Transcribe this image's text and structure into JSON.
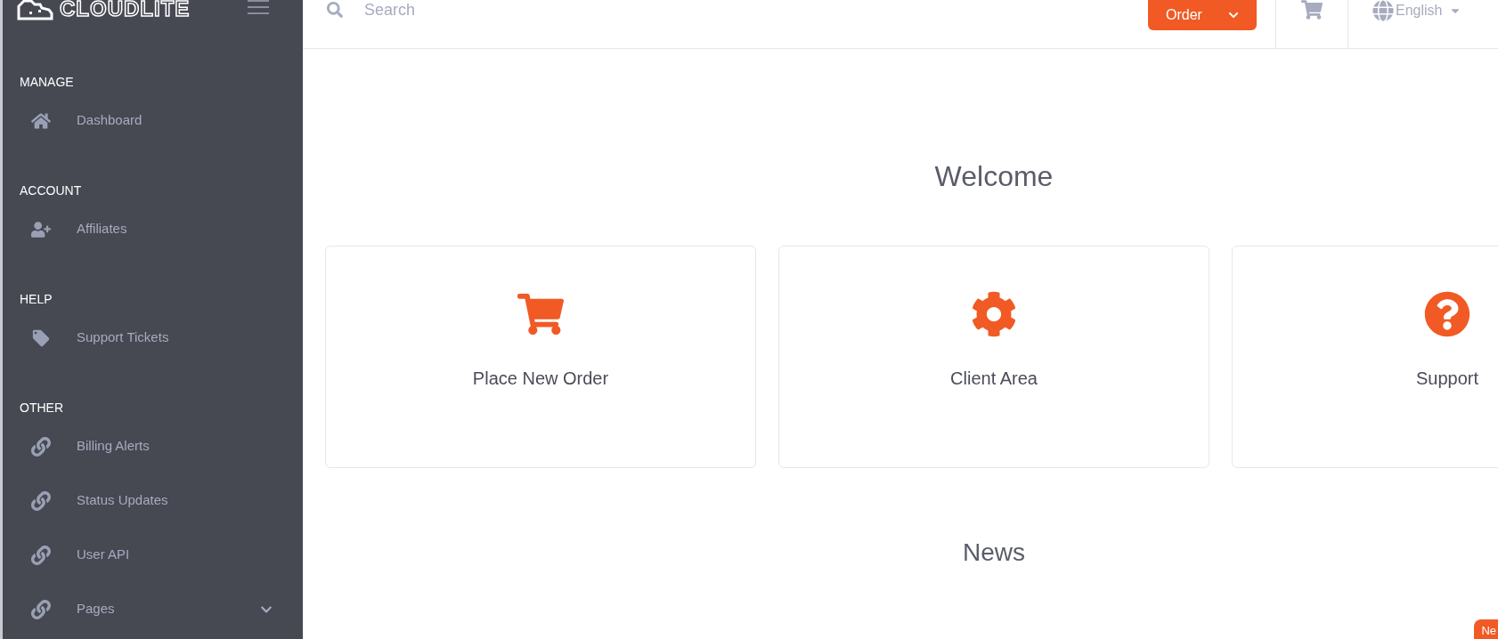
{
  "brand": {
    "logo_text": "CLOUDLITE"
  },
  "sidebar": {
    "sections": [
      {
        "heading": "MANAGE",
        "items": [
          {
            "label": "Dashboard",
            "kind": "home",
            "expandable": false
          }
        ]
      },
      {
        "heading": "ACCOUNT",
        "items": [
          {
            "label": "Affiliates",
            "kind": "users",
            "expandable": false
          }
        ]
      },
      {
        "heading": "HELP",
        "items": [
          {
            "label": "Support Tickets",
            "kind": "tickets",
            "expandable": false
          }
        ]
      },
      {
        "heading": "OTHER",
        "items": [
          {
            "label": "Billing Alerts",
            "kind": "link",
            "expandable": false
          },
          {
            "label": "Status Updates",
            "kind": "link",
            "expandable": false
          },
          {
            "label": "User API",
            "kind": "link",
            "expandable": false
          },
          {
            "label": "Pages",
            "kind": "link",
            "expandable": true
          }
        ]
      }
    ]
  },
  "topbar": {
    "search": {
      "placeholder": "Search"
    },
    "order_button": "Order",
    "language": "English"
  },
  "main": {
    "welcome_title": "Welcome",
    "cards": [
      {
        "label": "Place New Order",
        "kind": "cart"
      },
      {
        "label": "Client Area",
        "kind": "gear"
      },
      {
        "label": "Support",
        "kind": "question"
      }
    ],
    "news_title": "News",
    "badge": "Ne"
  }
}
